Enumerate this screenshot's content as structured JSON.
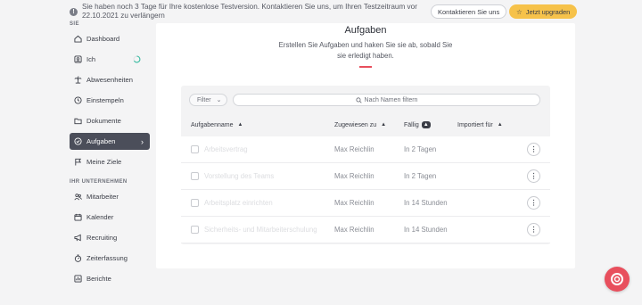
{
  "banner": {
    "text": "Sie haben noch 3 Tage für Ihre kostenlose Testversion. Kontaktieren Sie uns, um Ihren Testzeitraum vor 22.10.2021 zu verlängern",
    "contact_label": "Kontaktieren Sie uns",
    "upgrade_label": "Jetzt upgraden"
  },
  "sidebar": {
    "section1": "SIE",
    "section2": "IHR UNTERNEHMEN",
    "items": [
      {
        "label": "Dashboard",
        "icon": "home-icon"
      },
      {
        "label": "Ich",
        "icon": "person-icon"
      },
      {
        "label": "Abwesenheiten",
        "icon": "palm-tree-icon"
      },
      {
        "label": "Einstempeln",
        "icon": "clock-icon"
      },
      {
        "label": "Dokumente",
        "icon": "folder-icon"
      },
      {
        "label": "Aufgaben",
        "icon": "check-circle-icon"
      },
      {
        "label": "Meine Ziele",
        "icon": "flag-icon"
      }
    ],
    "company_items": [
      {
        "label": "Mitarbeiter",
        "icon": "people-icon"
      },
      {
        "label": "Kalender",
        "icon": "calendar-icon"
      },
      {
        "label": "Recruiting",
        "icon": "megaphone-icon"
      },
      {
        "label": "Zeiterfassung",
        "icon": "stopwatch-icon"
      },
      {
        "label": "Berichte",
        "icon": "chart-icon"
      }
    ]
  },
  "main": {
    "title": "Aufgaben",
    "description": "Erstellen Sie Aufgaben und haken Sie sie ab, sobald Sie sie erledigt haben.",
    "filter_label": "Filter",
    "search_placeholder": "Nach Namen filtern",
    "columns": {
      "name": "Aufgabenname",
      "assignee": "Zugewiesen zu",
      "due": "Fällig",
      "imported": "Importiert für"
    },
    "rows": [
      {
        "name": "Arbeitsvertrag",
        "assignee": "Max Reichlin",
        "due": "In 2 Tagen"
      },
      {
        "name": "Vorstellung des Teams",
        "assignee": "Max Reichlin",
        "due": "In 2 Tagen"
      },
      {
        "name": "Arbeitsplatz einrichten",
        "assignee": "Max Reichlin",
        "due": "In 14 Stunden"
      },
      {
        "name": "Sicherheits- und Mitarbeiterschulung",
        "assignee": "Max Reichlin",
        "due": "In 14 Stunden"
      }
    ]
  },
  "colors": {
    "accent": "#e84f5d",
    "upgrade": "#f6c24a",
    "active_nav": "#4b4e5a",
    "progress": "#3fbfa5"
  }
}
